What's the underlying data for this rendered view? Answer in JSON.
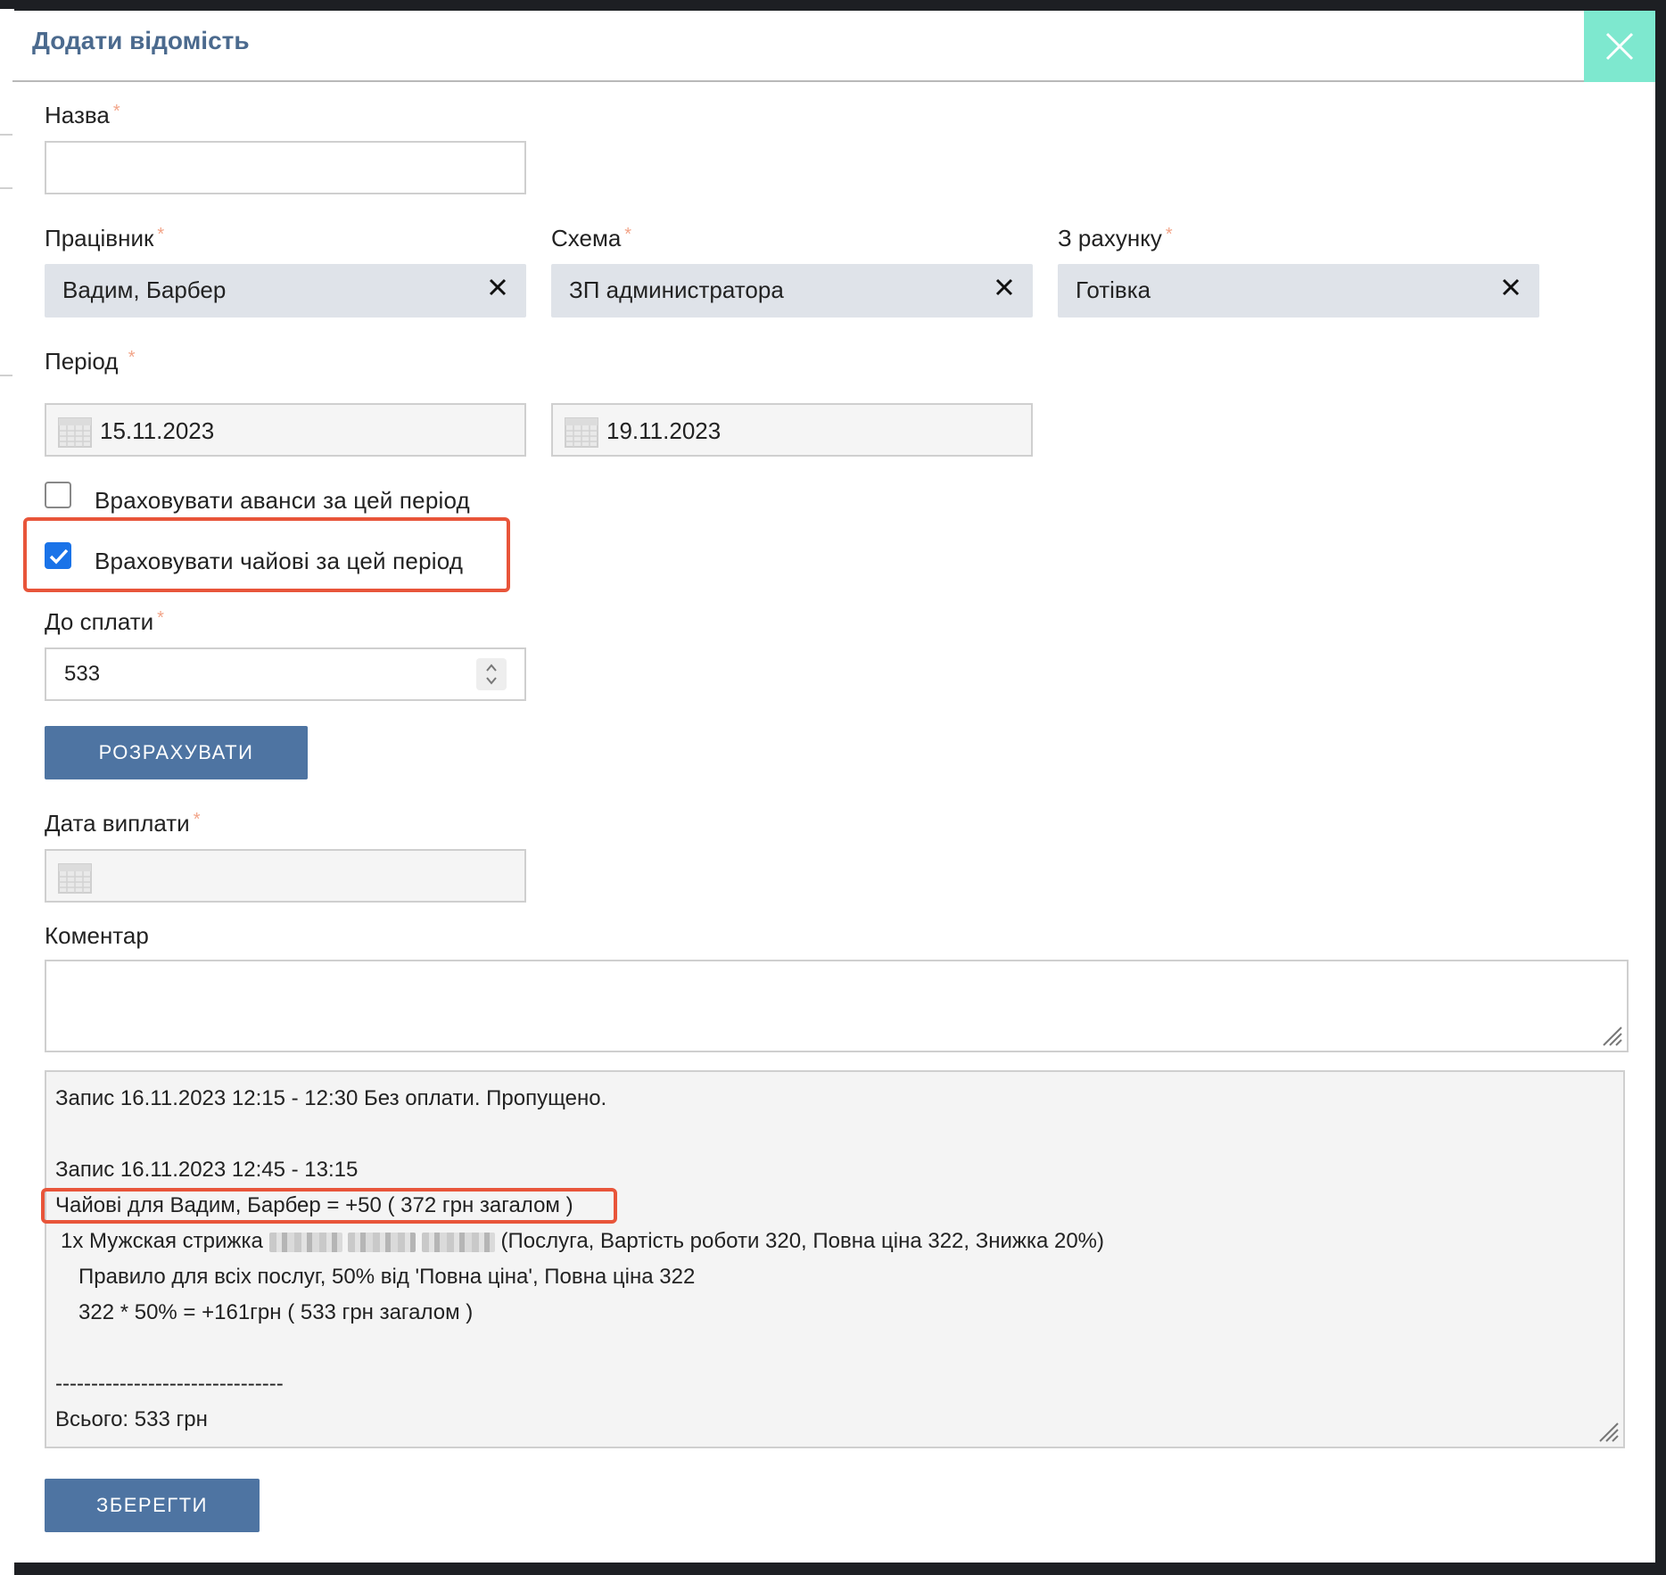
{
  "modal": {
    "title": "Додати відомість",
    "close_label": "×"
  },
  "form": {
    "name": {
      "label": "Назва",
      "required": "*",
      "value": ""
    },
    "employee": {
      "label": "Працівник",
      "required": "*",
      "value": "Вадим, Барбер"
    },
    "scheme": {
      "label": "Схема",
      "required": "*",
      "value": "ЗП администратора"
    },
    "account": {
      "label": "З рахунку",
      "required": "*",
      "value": "Готівка"
    },
    "period": {
      "label": "Період",
      "required": "*",
      "from": "15.11.2023",
      "to": "19.11.2023"
    },
    "advances_checkbox": {
      "label": "Враховувати аванси за цей період",
      "checked": false
    },
    "tips_checkbox": {
      "label": "Враховувати чайові за цей період",
      "checked": true
    },
    "to_pay": {
      "label": "До сплати",
      "required": "*",
      "value": "533"
    },
    "calculate_button": "РОЗРАХУВАТИ",
    "pay_date": {
      "label": "Дата виплати",
      "required": "*",
      "value": ""
    },
    "comment": {
      "label": "Коментар",
      "value": ""
    },
    "save_button": "ЗБЕРЕГТИ"
  },
  "log": {
    "line1": "Запис 16.11.2023 12:15 - 12:30 Без оплати. Пропущено.",
    "line2": "Запис 16.11.2023 12:45 - 13:15",
    "tips_line": "Чайові для Вадим, Барбер = +50 ( 372 грн загалом )",
    "service_prefix": "1x Мужская стрижка",
    "service_suffix": "(Послуга, Вартість роботи 320, Повна ціна 322, Знижка 20%)",
    "rule_line": "Правило для всіх послуг, 50% від 'Повна ціна', Повна ціна 322",
    "calc_line": "322 * 50% = +161грн ( 533 грн загалом )",
    "separator": "--------------------------------",
    "total": "Всього: 533 грн"
  },
  "colors": {
    "title": "#4b6a8e",
    "close_bg": "#7ee8cf",
    "button_bg": "#4e74a2",
    "highlight": "#e8553a",
    "checkbox_on": "#1a73e8"
  }
}
